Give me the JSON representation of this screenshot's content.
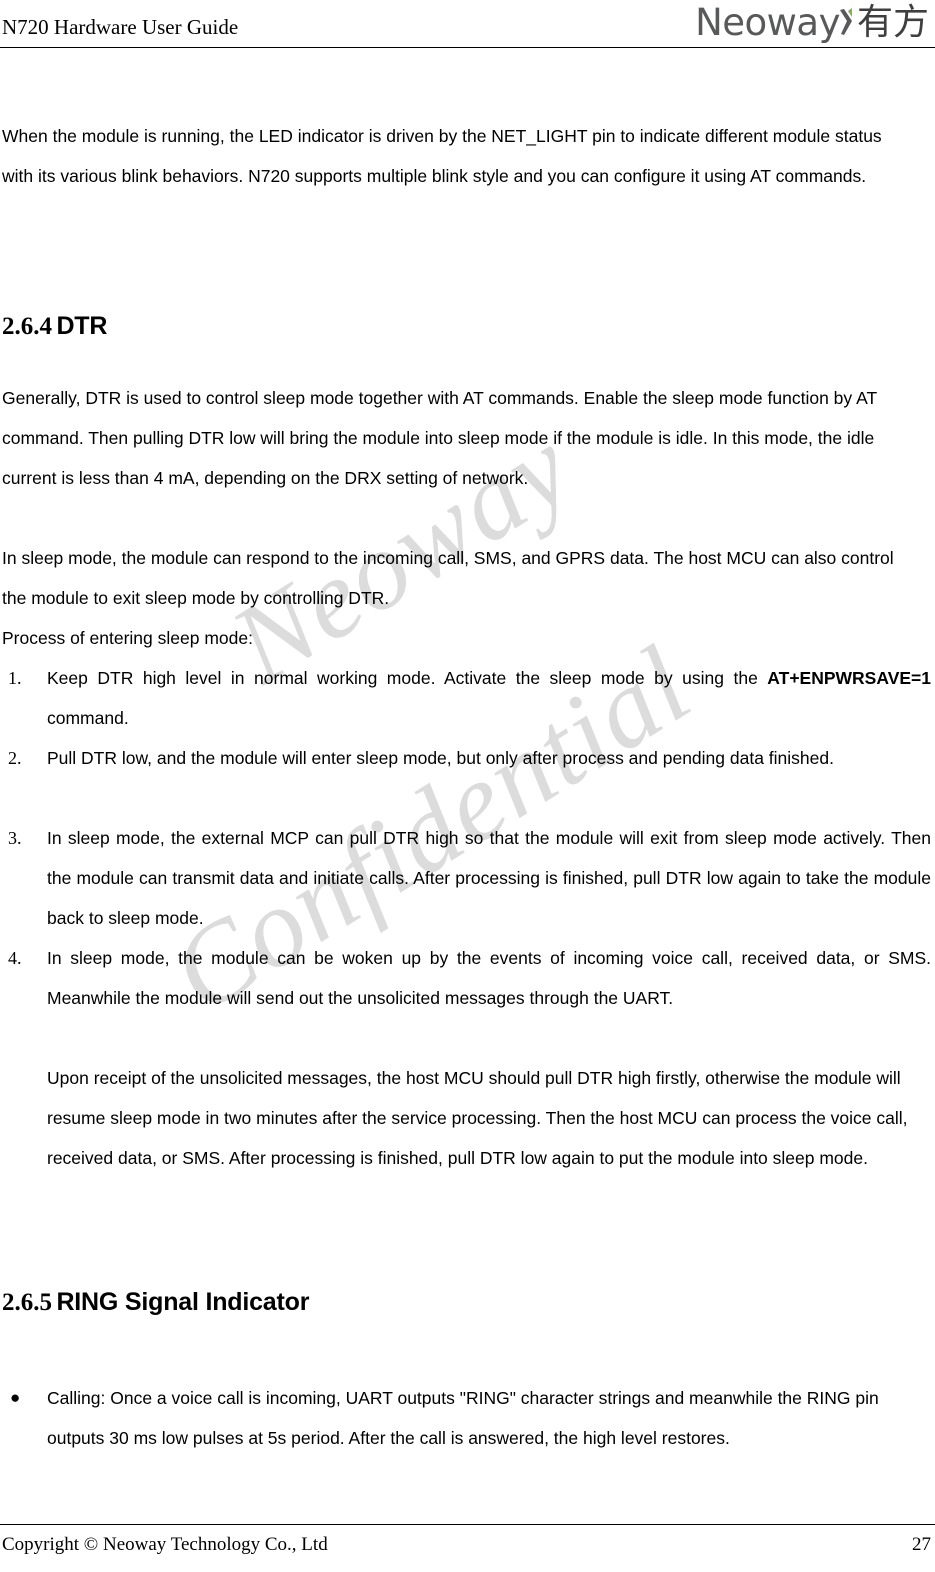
{
  "header": {
    "title": "N720 Hardware User Guide",
    "logo": {
      "word": "Neoway",
      "chinese": "有方",
      "accent_color": "#7ab648",
      "word_color": "#58595b"
    }
  },
  "watermark": {
    "line1": "Neoway",
    "line2": "Confidential",
    "color": "#dcdcdc"
  },
  "body": {
    "intro_paragraph": "When the module is running, the LED indicator is driven by the NET_LIGHT pin to indicate different module status with its various blink behaviors. N720 supports multiple blink style and you can configure it using AT commands.",
    "section_dtr": {
      "number": "2.6.4",
      "title": "DTR",
      "paragraph1": "Generally, DTR is used to control sleep mode together with AT commands. Enable the sleep mode function by AT command. Then pulling DTR low will bring the module into sleep mode if the module is idle. In this mode, the idle current is less than 4 mA, depending on the DRX setting of network.",
      "paragraph2": "In sleep mode, the module can respond to the incoming call, SMS, and GPRS data. The host MCU can also control the module to exit sleep mode by controlling DTR.",
      "paragraph3": "Process of entering sleep mode:",
      "steps": [
        {
          "marker": "1.",
          "text_before": "Keep DTR high level in normal working mode. Activate the sleep mode by using the ",
          "bold": "AT+ENPWRSAVE=1",
          "text_after": " command."
        },
        {
          "marker": "2.",
          "text_before": "Pull DTR low, and the module will enter sleep mode, but only after process and pending data finished.",
          "bold": "",
          "text_after": ""
        },
        {
          "marker": "3.",
          "text_before": "In sleep mode, the external MCP can pull DTR high so that the module will exit from sleep mode actively. Then the module can transmit data and initiate calls. After processing is finished, pull DTR low again to take the module back to sleep mode.",
          "bold": "",
          "text_after": ""
        },
        {
          "marker": "4.",
          "text_before": "In sleep mode, the module can be woken up by the events of incoming voice call, received data, or SMS. Meanwhile the module will send out the unsolicited messages through the UART.",
          "bold": "",
          "text_after": ""
        }
      ],
      "step4_note": "Upon receipt of the unsolicited messages, the host MCU should pull DTR high firstly, otherwise the module will resume sleep mode in two minutes after the service processing. Then the host MCU can process the voice call, received data, or SMS. After processing is finished, pull DTR low again to put the module into sleep mode."
    },
    "section_ring": {
      "number": "2.6.5",
      "title": "RING Signal Indicator",
      "bullets": [
        {
          "marker": "●",
          "text": "Calling: Once a voice call is incoming, UART outputs \"RING\" character strings and meanwhile the RING pin outputs 30 ms low pulses at 5s period. After the call is answered, the high level restores."
        }
      ]
    }
  },
  "footer": {
    "copyright": "Copyright © Neoway Technology Co., Ltd",
    "page_number": "27"
  }
}
